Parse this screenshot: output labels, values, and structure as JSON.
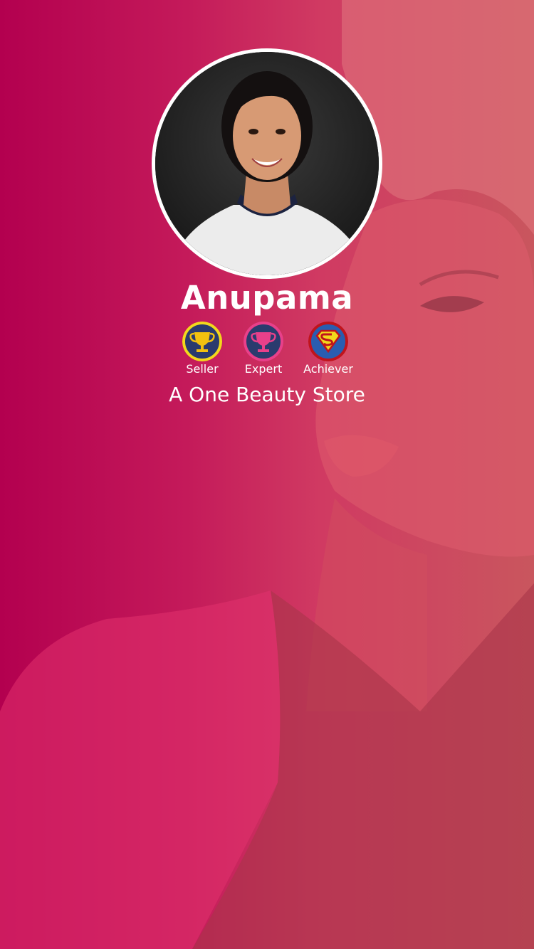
{
  "profile": {
    "name": "Anupama",
    "store_name": "A One Beauty Store"
  },
  "badges": [
    {
      "label": "Seller",
      "icon": "trophy-icon",
      "ring_color": "#f2d81c",
      "fill_color": "#2a3b6e"
    },
    {
      "label": "Expert",
      "icon": "trophy-icon",
      "ring_color": "#e8408a",
      "fill_color": "#2a3b6e"
    },
    {
      "label": "Achiever",
      "icon": "superman-shield-icon",
      "ring_color": "#c0141c",
      "fill_color": "#2a5db0"
    }
  ],
  "colors": {
    "background_start": "#b3004f",
    "background_end": "#c9565e",
    "text": "#ffffff"
  }
}
